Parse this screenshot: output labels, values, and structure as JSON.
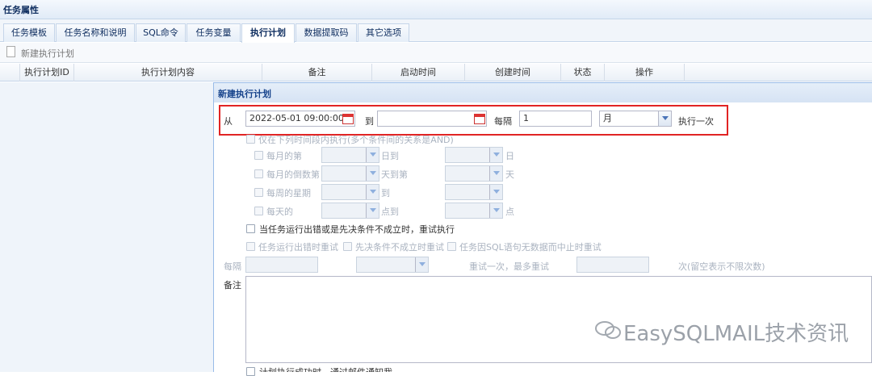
{
  "window": {
    "title": "任务属性"
  },
  "tabs": [
    {
      "label": "任务模板"
    },
    {
      "label": "任务名称和说明"
    },
    {
      "label": "SQL命令"
    },
    {
      "label": "任务变量"
    },
    {
      "label": "执行计划"
    },
    {
      "label": "数据提取码"
    },
    {
      "label": "其它选项"
    }
  ],
  "toolbar": {
    "new_label": "新建执行计划"
  },
  "grid": {
    "columns": [
      "执行计划ID",
      "执行计划内容",
      "备注",
      "启动时间",
      "创建时间",
      "状态",
      "操作"
    ]
  },
  "dialog": {
    "title": "新建执行计划",
    "from_label": "从",
    "from_value": "2022-05-01 09:00:00",
    "to_label": "到",
    "to_value": "",
    "every_label": "每隔",
    "every_value": "1",
    "unit_value": "月",
    "exec_once_label": "执行一次",
    "only_in_label": "仅在下列时间段内执行(多个条件间的关系是AND)",
    "rows": [
      {
        "label": "每月的第",
        "mid": "日到",
        "end": "日"
      },
      {
        "label": "每月的倒数第",
        "mid": "天到第",
        "end": "天"
      },
      {
        "label": "每周的星期",
        "mid": "到",
        "end": ""
      },
      {
        "label": "每天的",
        "mid": "点到",
        "end": "点"
      }
    ],
    "retry_label": "当任务运行出错或是先决条件不成立时，重试执行",
    "retry_opts": [
      "任务运行出错时重试",
      "先决条件不成立时重试",
      "任务因SQL语句无数据而中止时重试"
    ],
    "retry_every_label": "每隔",
    "retry_mid_label": "重试一次，最多重试",
    "retry_end_label": "次(留空表示不限次数)",
    "notes_label": "备注",
    "bottom_label": "计划执行成功时，通过邮件通知我"
  },
  "watermark": {
    "text": "EasySQLMAIL技术资讯"
  }
}
